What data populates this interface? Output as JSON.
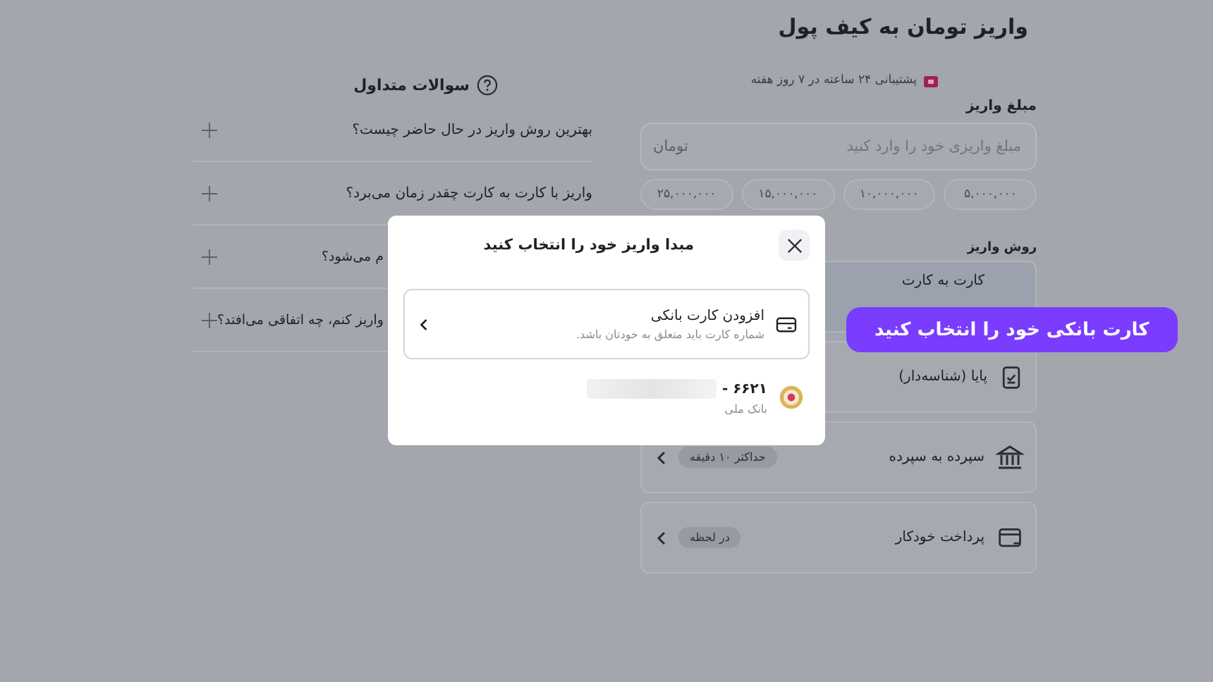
{
  "page_title": "واریز تومان به کیف پول",
  "support": "پشتیبانی ۲۴ ساعته در ۷ روز هفته",
  "amount": {
    "label": "مبلغ واریز",
    "placeholder": "مبلغ واریزی خود را وارد کنید",
    "unit": "تومان"
  },
  "presets": [
    "۵,۰۰۰,۰۰۰",
    "۱۰,۰۰۰,۰۰۰",
    "۱۵,۰۰۰,۰۰۰",
    "۲۵,۰۰۰,۰۰۰"
  ],
  "methods_label": "روش واریز",
  "methods": [
    {
      "kind": "card",
      "name": "کارت به کارت",
      "selected": true
    },
    {
      "kind": "receipt",
      "name": "پایا (شناسه‌دار)",
      "selected": false
    },
    {
      "kind": "bank",
      "name": "سپرده به سپرده",
      "badge": "حداکثر ۱۰ دقیقه",
      "selected": false
    },
    {
      "kind": "autopay",
      "name": "پرداخت خودکار",
      "badge": "در لحظه",
      "selected": false
    }
  ],
  "faq": {
    "title": "سوالات متداول",
    "items": [
      {
        "kind": "full",
        "question": "بهترین روش واریز در حال حاضر چیست؟"
      },
      {
        "kind": "full",
        "question": "واریز با کارت به کارت چقدر زمان می‌برد؟"
      },
      {
        "kind": "partial",
        "question": "م می‌شود؟"
      },
      {
        "kind": "partial",
        "question": "واریز کنم، چه اتفاقی می‌افتد؟"
      }
    ]
  },
  "modal": {
    "title": "مبدا واریز خود را انتخاب کنید",
    "add_card": {
      "title": "افزودن کارت بانکی",
      "subtitle": "شماره کارت باید متعلق به خودتان باشد."
    },
    "cards": [
      {
        "number": "۶۶۲۱ -",
        "bank": "بانک ملی"
      }
    ]
  },
  "callout": "کارت بانکی خود را انتخاب کنید"
}
